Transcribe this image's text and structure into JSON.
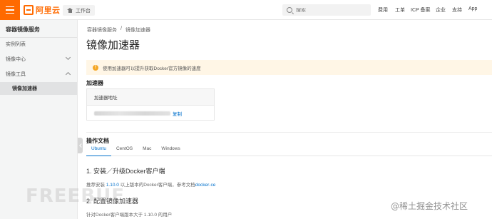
{
  "topbar": {
    "logo_text": "阿里云",
    "workbench_label": "工作台",
    "search_placeholder": "搜索",
    "links": [
      "费用",
      "工单",
      "ICP 备案",
      "企业",
      "支持",
      "App"
    ]
  },
  "sidebar": {
    "title": "容器镜像服务",
    "items": [
      {
        "label": "实例列表"
      },
      {
        "label": "镜像中心"
      },
      {
        "label": "镜像工具"
      },
      {
        "label": "镜像加速器"
      }
    ]
  },
  "breadcrumb": [
    "容器镜像服务",
    "/",
    "镜像加速器"
  ],
  "page_title": "镜像加速器",
  "alert_text": "使用加速器可以提升获取Docker官方镜像的速度",
  "accelerator": {
    "section_title": "加速器",
    "column_header": "加速器地址",
    "copy_label": "复制"
  },
  "docs": {
    "section_title": "操作文档",
    "tabs": [
      "Ubuntu",
      "CentOS",
      "Mac",
      "Windows"
    ],
    "step1_title": "1. 安装／升级Docker客户端",
    "step1_text_a": "推荐安装",
    "step1_version": "1.10.0",
    "step1_text_b": "以上版本的Docker客户端，参考文档",
    "step1_link": "docker-ce",
    "step2_title": "2. 配置镜像加速器",
    "step2_text": "针对Docker客户端版本大于 1.10.0 的用户"
  },
  "watermarks": {
    "left": "FREEBUF",
    "right": "@稀土掘金技术社区"
  },
  "colors": {
    "brand": "#ff6a00",
    "link": "#0070cc",
    "alert_bg": "#fff6e6",
    "alert_icon": "#f5a623"
  }
}
